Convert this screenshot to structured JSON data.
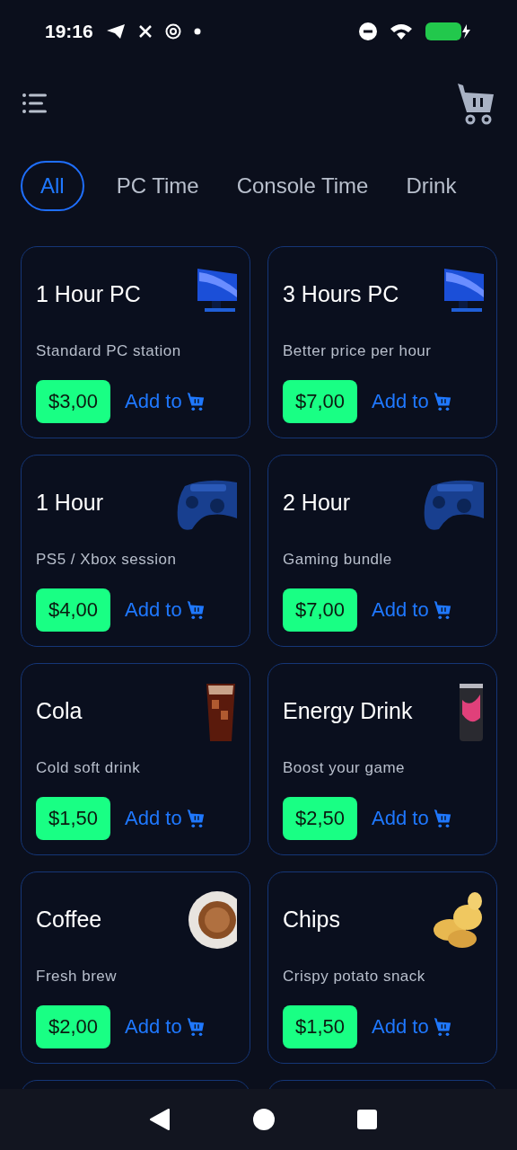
{
  "status_bar": {
    "time": "19:16"
  },
  "tabs": [
    {
      "label": "All",
      "selected": true
    },
    {
      "label": "PC Time",
      "selected": false
    },
    {
      "label": "Console Time",
      "selected": false
    },
    {
      "label": "Drink",
      "selected": false
    }
  ],
  "products": [
    {
      "title": "1 Hour PC",
      "description": "Standard PC station",
      "price": "$3,00",
      "action": "Add to",
      "kind": "monitor"
    },
    {
      "title": "3 Hours PC",
      "description": "Better price per hour",
      "price": "$7,00",
      "action": "Add to",
      "kind": "monitor"
    },
    {
      "title": "1 Hour",
      "description": "PS5 / Xbox session",
      "price": "$4,00",
      "action": "Add to",
      "kind": "gamepad"
    },
    {
      "title": "2 Hour",
      "description": "Gaming bundle",
      "price": "$7,00",
      "action": "Add to",
      "kind": "gamepad"
    },
    {
      "title": "Cola",
      "description": "Cold soft drink",
      "price": "$1,50",
      "action": "Add to",
      "kind": "glass"
    },
    {
      "title": "Energy Drink",
      "description": "Boost your game",
      "price": "$2,50",
      "action": "Add to",
      "kind": "can"
    },
    {
      "title": "Coffee",
      "description": "Fresh brew",
      "price": "$2,00",
      "action": "Add to",
      "kind": "cup"
    },
    {
      "title": "Chips",
      "description": "Crispy potato snack",
      "price": "$1,50",
      "action": "Add to",
      "kind": "chips"
    }
  ]
}
